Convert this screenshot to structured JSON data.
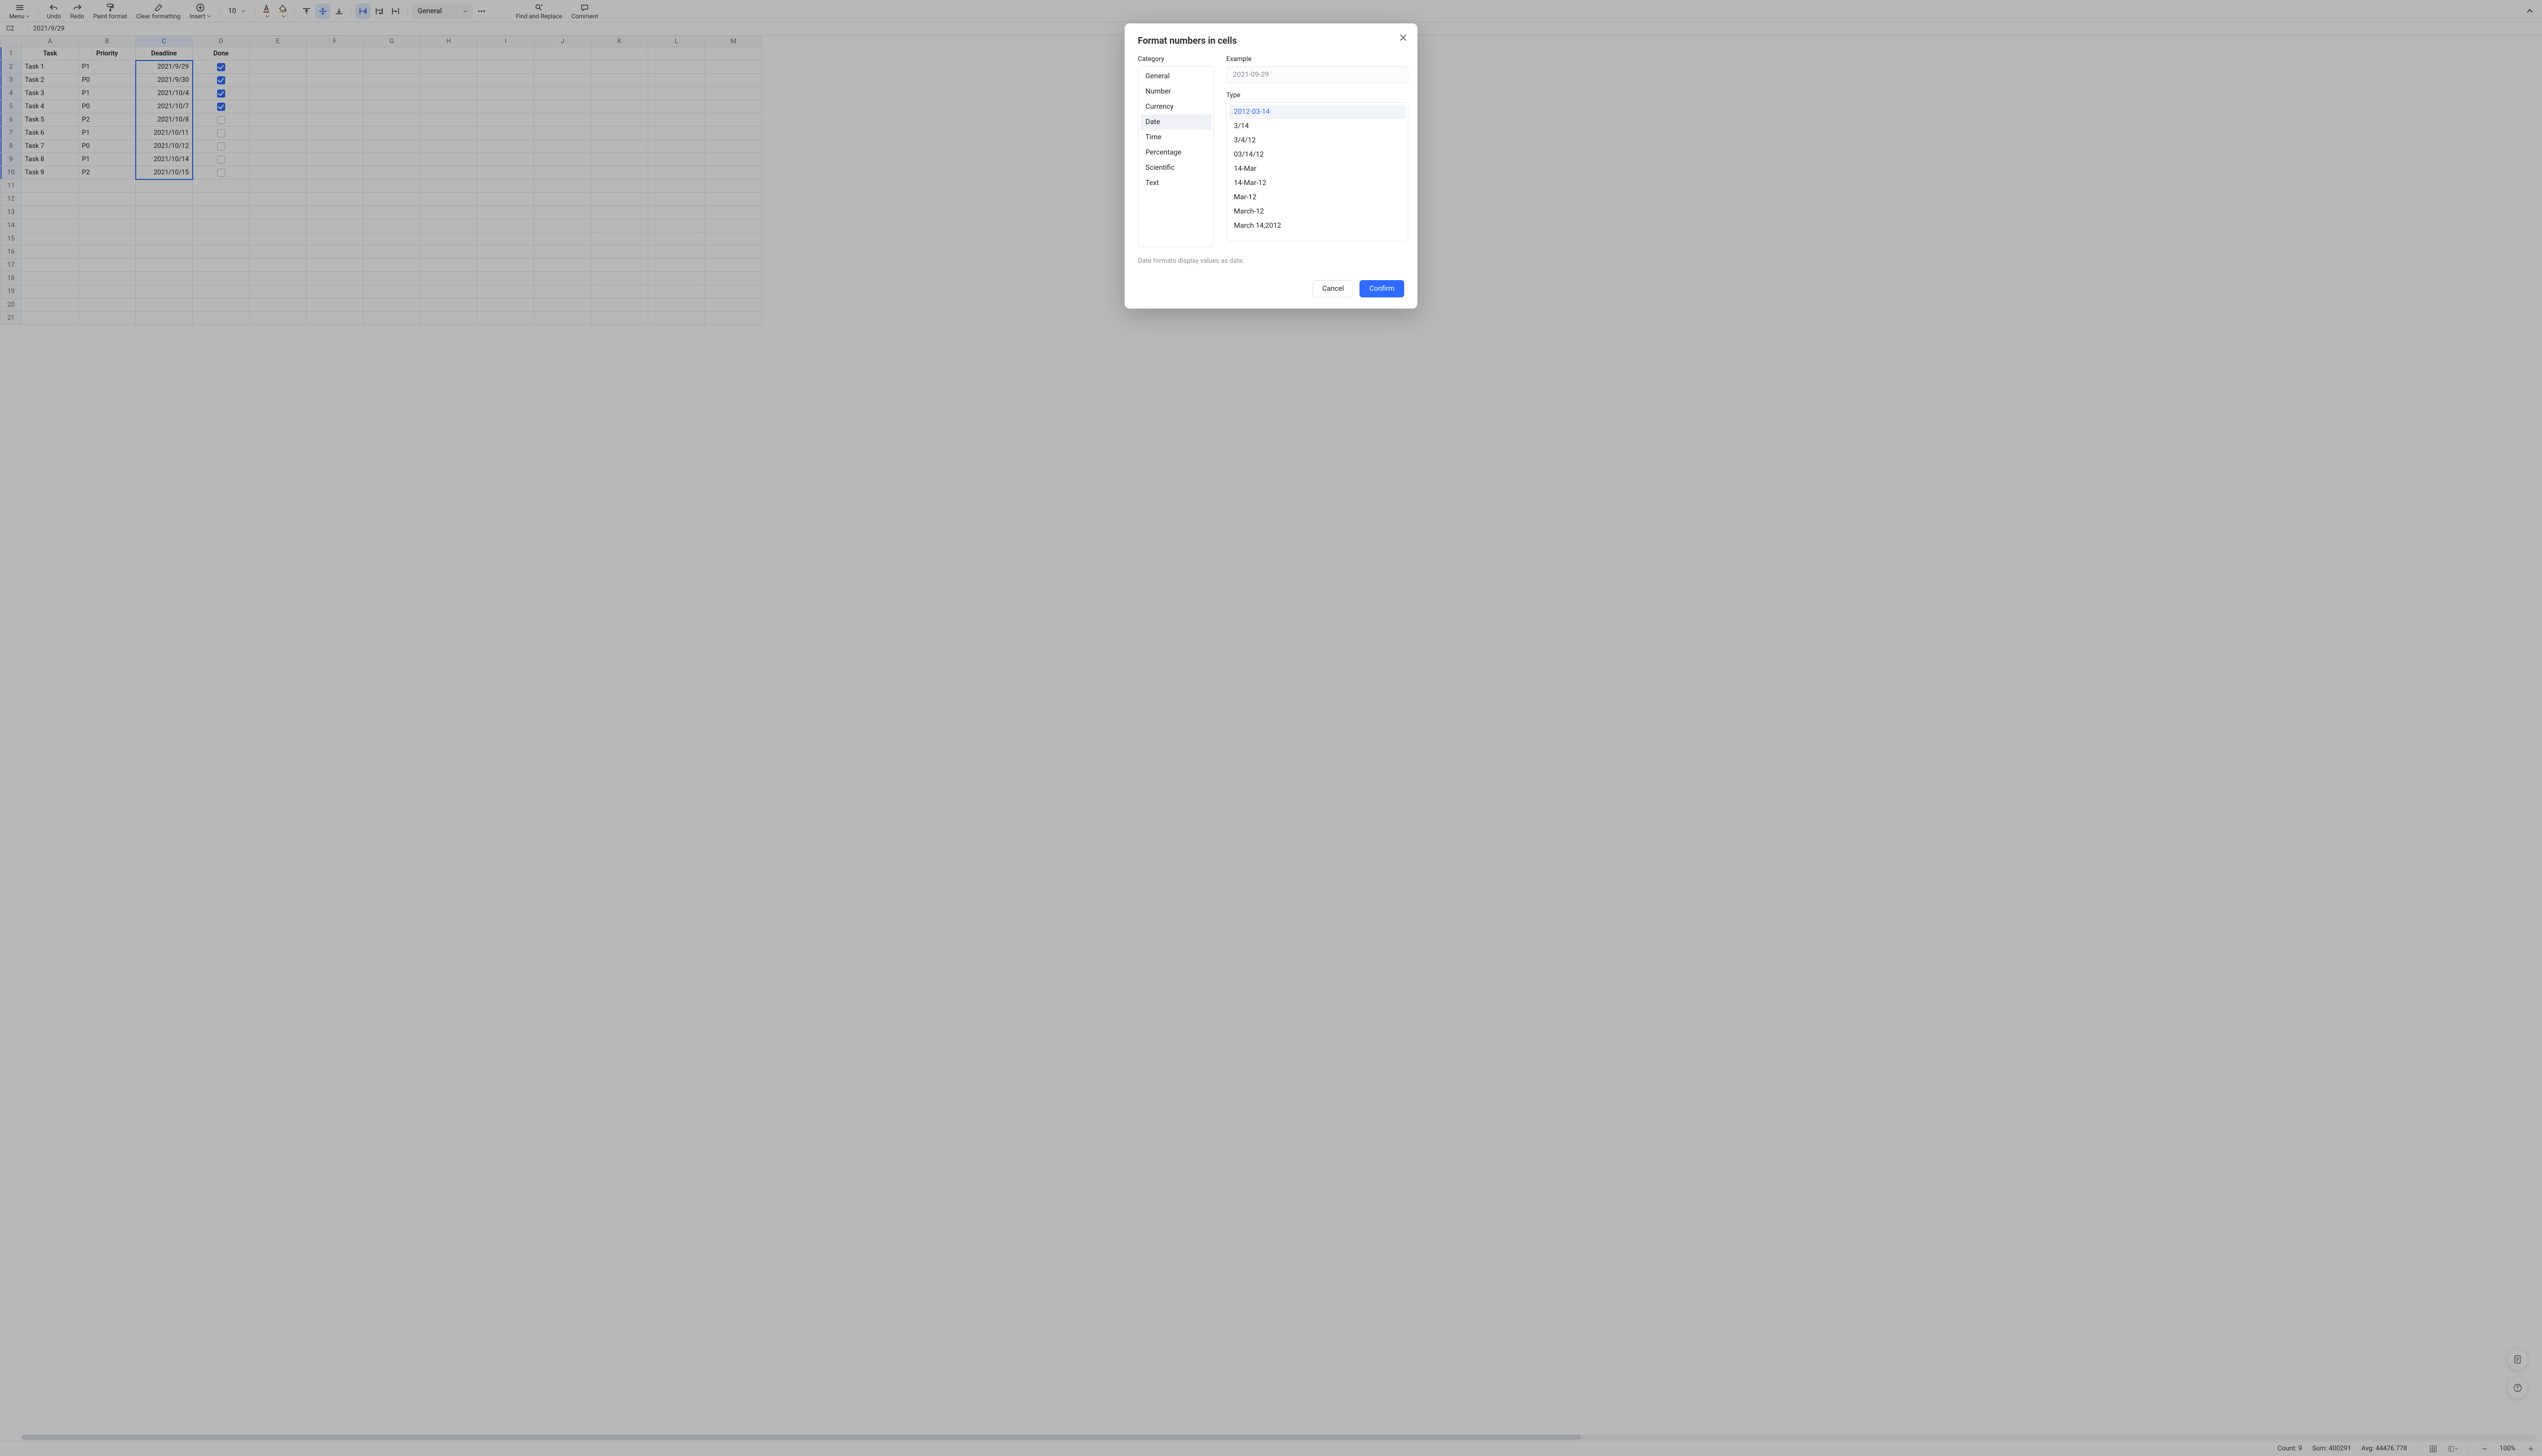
{
  "toolbar": {
    "menu": "Menu",
    "undo": "Undo",
    "redo": "Redo",
    "paint_format": "Paint format",
    "clear_formatting": "Clear formatting",
    "insert": "Insert",
    "font_size": "10",
    "number_format": "General",
    "find_replace": "Find and Replace",
    "comment": "Comment"
  },
  "formula_bar": {
    "name_box": "C2",
    "formula": "2021/9/29"
  },
  "columns": [
    "A",
    "B",
    "C",
    "D",
    "E",
    "F",
    "G",
    "H",
    "I",
    "J",
    "K",
    "L",
    "M"
  ],
  "row_count": 21,
  "headers": {
    "A": "Task",
    "B": "Priority",
    "C": "Deadline",
    "D": "Done"
  },
  "rows": [
    {
      "task": "Task 1",
      "priority": "P1",
      "deadline": "2021/9/29",
      "done": true
    },
    {
      "task": "Task 2",
      "priority": "P0",
      "deadline": "2021/9/30",
      "done": true
    },
    {
      "task": "Task 3",
      "priority": "P1",
      "deadline": "2021/10/4",
      "done": true
    },
    {
      "task": "Task 4",
      "priority": "P0",
      "deadline": "2021/10/7",
      "done": true
    },
    {
      "task": "Task 5",
      "priority": "P2",
      "deadline": "2021/10/8",
      "done": false
    },
    {
      "task": "Task 6",
      "priority": "P1",
      "deadline": "2021/10/11",
      "done": false
    },
    {
      "task": "Task 7",
      "priority": "P0",
      "deadline": "2021/10/12",
      "done": false
    },
    {
      "task": "Task 8",
      "priority": "P1",
      "deadline": "2021/10/14",
      "done": false
    },
    {
      "task": "Task 9",
      "priority": "P2",
      "deadline": "2021/10/15",
      "done": false
    }
  ],
  "statusbar": {
    "count_label": "Count:",
    "count": "9",
    "sum_label": "Sum:",
    "sum": "400291",
    "avg_label": "Avg:",
    "avg": "44476.778",
    "zoom": "100%"
  },
  "modal": {
    "title": "Format numbers in cells",
    "category_label": "Category",
    "example_label": "Example",
    "type_label": "Type",
    "example_value": "2021-09-29",
    "categories": [
      "General",
      "Number",
      "Currency",
      "Date",
      "Time",
      "Percentage",
      "Scientific",
      "Text"
    ],
    "selected_category": "Date",
    "types": [
      "2012-03-14",
      "3/14",
      "3/4/12",
      "03/14/12",
      "14-Mar",
      "14-Mar-12",
      "Mar-12",
      "March-12",
      "March 14,2012"
    ],
    "selected_type": "2012-03-14",
    "helper": "Date formats display values as date.",
    "cancel": "Cancel",
    "confirm": "Confirm"
  }
}
